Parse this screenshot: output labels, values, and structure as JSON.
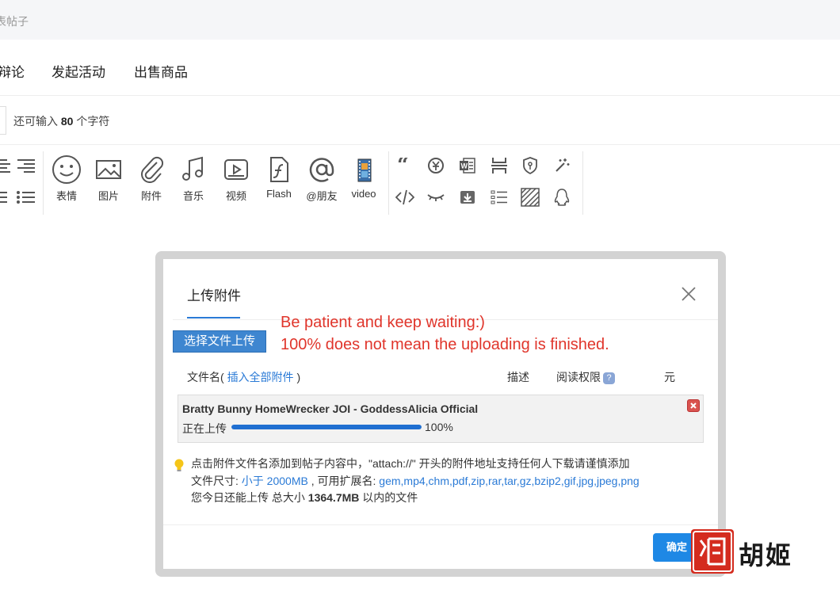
{
  "topbar": {
    "title": "表帖子"
  },
  "tabs": [
    {
      "label": "辩论"
    },
    {
      "label": "发起活动"
    },
    {
      "label": "出售商品"
    }
  ],
  "title_row": {
    "prefix": "还可输入",
    "count": "80",
    "suffix": "个字符"
  },
  "toolbar": {
    "tools": [
      {
        "label": "表情",
        "icon": "smiley-icon"
      },
      {
        "label": "图片",
        "icon": "image-icon"
      },
      {
        "label": "附件",
        "icon": "paperclip-icon"
      },
      {
        "label": "音乐",
        "icon": "music-icon"
      },
      {
        "label": "视频",
        "icon": "video-icon"
      },
      {
        "label": "Flash",
        "icon": "flash-icon"
      },
      {
        "label": "@朋友",
        "icon": "at-icon"
      },
      {
        "label": "video",
        "icon": "film-icon"
      }
    ]
  },
  "modal": {
    "tab": "上传附件",
    "upload_button": "选择文件上传",
    "note_line1": "Be patient and keep waiting:)",
    "note_line2": "100% does not mean the uploading is finished.",
    "columns": {
      "filename": "文件名",
      "insert_all_open": "( ",
      "insert_all": "插入全部附件",
      "insert_all_close": " )",
      "description": "描述",
      "permission": "阅读权限",
      "help": "?",
      "price": "元"
    },
    "file": {
      "name": "Bratty Bunny HomeWrecker JOI - GoddessAlicia Official",
      "status": "正在上传",
      "progress": 1.0,
      "progress_text": "100%"
    },
    "info": {
      "line1": "点击附件文件名添加到帖子内容中，\"attach://\" 开头的附件地址支持任何人下载请谨慎添加",
      "line2_prefix": "文件尺寸: ",
      "line2_size": "小于 2000MB",
      "line2_mid": " , 可用扩展名: ",
      "line2_ext": "gem,mp4,chm,pdf,zip,rar,tar,gz,bzip2,gif,jpg,jpeg,png",
      "line3_prefix": "您今日还能上传 总大小 ",
      "line3_size": "1364.7MB",
      "line3_suffix": " 以内的文件"
    },
    "confirm_button": "确定"
  },
  "watermark": {
    "text": "胡姬"
  },
  "colors": {
    "accent": "#2a7ad6",
    "note": "#e0352b",
    "progress": "#1f6fd1",
    "confirm": "#1e88e5"
  }
}
